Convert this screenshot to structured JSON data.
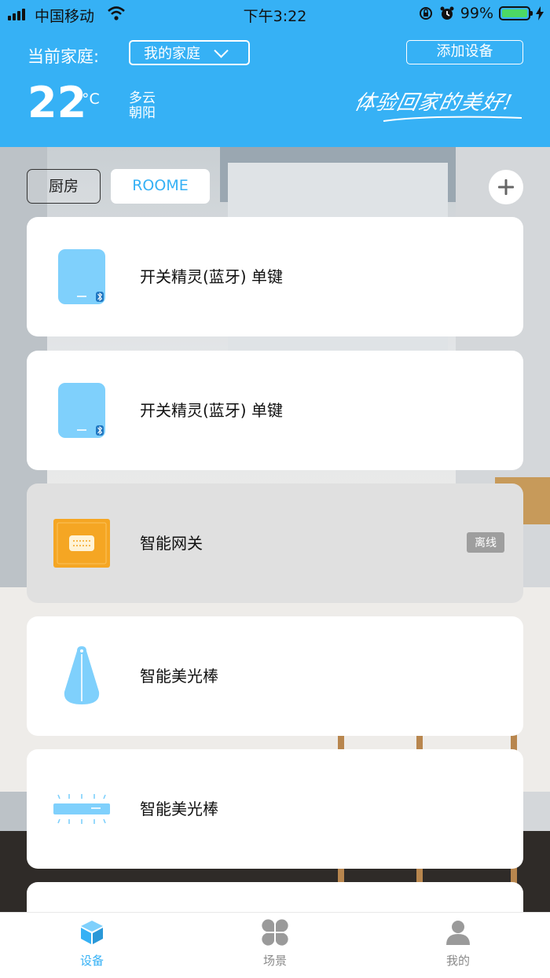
{
  "status_bar": {
    "carrier": "中国移动",
    "time": "下午3:22",
    "battery": "99%"
  },
  "header": {
    "family_label": "当前家庭:",
    "family_selected": "我的家庭",
    "add_device": "添加设备",
    "temperature": "22",
    "temperature_unit": "°C",
    "weather": "多云",
    "location": "朝阳",
    "slogan": "体验回家的美好!"
  },
  "rooms": [
    {
      "label": "厨房",
      "active": false
    },
    {
      "label": "ROOME",
      "active": true
    }
  ],
  "devices": [
    {
      "name": "开关精灵(蓝牙) 单键",
      "icon": "bluetooth-switch-icon",
      "status": ""
    },
    {
      "name": "开关精灵(蓝牙) 单键",
      "icon": "bluetooth-switch-icon",
      "status": ""
    },
    {
      "name": "智能网关",
      "icon": "gateway-icon",
      "status": "离线"
    },
    {
      "name": "智能美光棒",
      "icon": "light-drop-icon",
      "status": ""
    },
    {
      "name": "智能美光棒",
      "icon": "light-bar-icon",
      "status": ""
    }
  ],
  "tabbar": {
    "items": [
      {
        "label": "设备",
        "icon": "cube-icon",
        "active": true
      },
      {
        "label": "场景",
        "icon": "four-petal-icon",
        "active": false
      },
      {
        "label": "我的",
        "icon": "person-icon",
        "active": false
      }
    ]
  },
  "colors": {
    "accent": "#36b1f5",
    "offline_badge": "#9e9e9e",
    "battery": "#4cd964",
    "gateway": "#f5a623"
  }
}
